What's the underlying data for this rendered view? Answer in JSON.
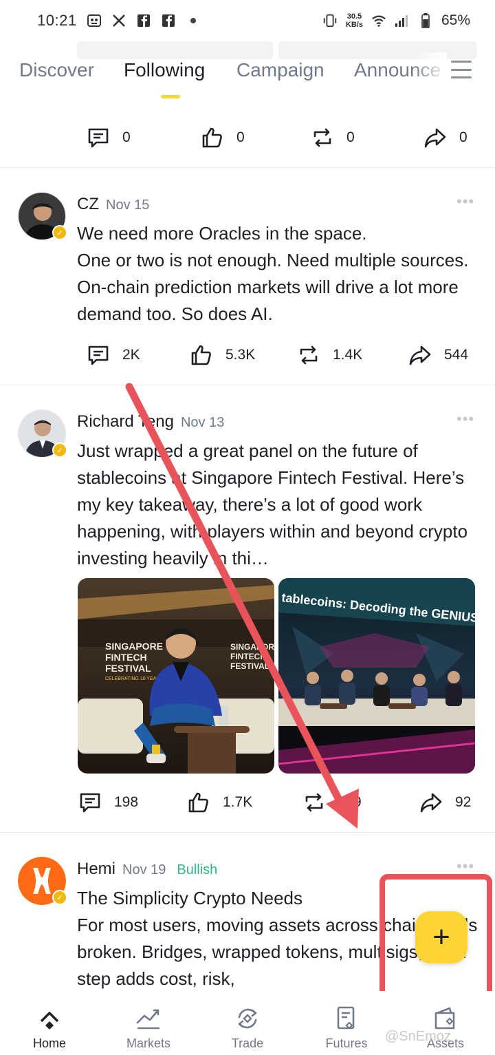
{
  "status_bar": {
    "time": "10:21",
    "net_speed_value": "30.5",
    "net_speed_unit": "KB/s",
    "battery": "65%"
  },
  "tabs": [
    {
      "label": "Discover"
    },
    {
      "label": "Following"
    },
    {
      "label": "Campaign"
    },
    {
      "label": "Announcements"
    }
  ],
  "prev_post_stats": {
    "comments": "0",
    "likes": "0",
    "reposts": "0",
    "shares": "0"
  },
  "posts": [
    {
      "author": "CZ",
      "date": "Nov 15",
      "text": "We need more Oracles in the space.\nOne or two is not enough. Need multiple sources. On-chain prediction markets will drive a lot more demand too. So does AI.",
      "stats": {
        "comments": "2K",
        "likes": "5.3K",
        "reposts": "1.4K",
        "shares": "544"
      }
    },
    {
      "author": "Richard Teng",
      "date": "Nov 13",
      "text": "Just wrapped a great panel on the future of stablecoins at Singapore Fintech Festival. Here’s my key takeaway, there’s a lot of good work happening, with players within and beyond crypto investing heavily in thi…",
      "images": [
        {
          "sign_line1": "SINGAPORE",
          "sign_line2": "FINTECH",
          "sign_line3": "FESTIVAL",
          "sign_line4": "CELEBRATING 10 YEARS"
        },
        {
          "screen_text": "tablecoins: Decoding the GENIUS Act"
        }
      ],
      "stats": {
        "comments": "198",
        "likes": "1.7K",
        "reposts": "9",
        "shares": "92"
      }
    },
    {
      "author": "Hemi",
      "date": "Nov 19",
      "sentiment": "Bullish",
      "text": "The Simplicity Crypto Needs\nFor most users, moving assets across chains feels broken. Bridges, wrapped tokens, multisigs; each step adds cost, risk,"
    }
  ],
  "fab": {
    "label": "+"
  },
  "bottom_nav": [
    {
      "label": "Home",
      "icon": "home-icon"
    },
    {
      "label": "Markets",
      "icon": "markets-icon"
    },
    {
      "label": "Trade",
      "icon": "trade-icon"
    },
    {
      "label": "Futures",
      "icon": "futures-icon"
    },
    {
      "label": "Assets",
      "icon": "wallet-icon"
    }
  ],
  "watermark": "@SnEmoz",
  "colors": {
    "accent": "#fcd535",
    "bullish": "#2ebd85",
    "annotation": "#e8545a",
    "muted": "#707a8a"
  }
}
